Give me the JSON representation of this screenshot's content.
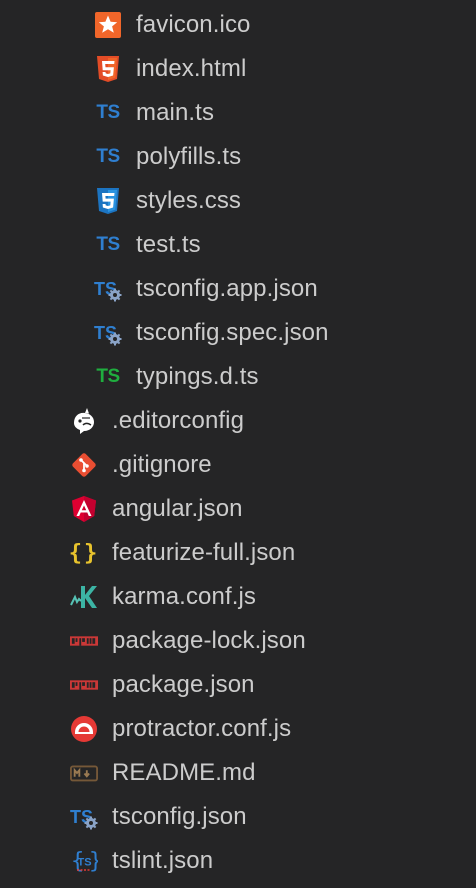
{
  "colors": {
    "background": "#252526",
    "text": "#cccccc",
    "ts_blue": "#2f7fd0",
    "ts_green": "#1fae3f",
    "html_orange": "#e34c26",
    "css_blue": "#1c74c1",
    "favicon_orange": "#f1662a",
    "angular_red": "#dd0031",
    "git_red": "#e94e32",
    "json_yellow": "#e8c32d",
    "karma_teal": "#56c3b5",
    "npm_red": "#cb3837",
    "protractor_red": "#e53935",
    "markdown_brown": "#755838"
  },
  "files": [
    {
      "label": "favicon.ico",
      "icon": "favicon-star-icon",
      "depth": 2
    },
    {
      "label": "index.html",
      "icon": "html5-icon",
      "depth": 2
    },
    {
      "label": "main.ts",
      "icon": "typescript-icon",
      "depth": 2
    },
    {
      "label": "polyfills.ts",
      "icon": "typescript-icon",
      "depth": 2
    },
    {
      "label": "styles.css",
      "icon": "css3-icon",
      "depth": 2
    },
    {
      "label": "test.ts",
      "icon": "typescript-icon",
      "depth": 2
    },
    {
      "label": "tsconfig.app.json",
      "icon": "tsconfig-icon",
      "depth": 2
    },
    {
      "label": "tsconfig.spec.json",
      "icon": "tsconfig-icon",
      "depth": 2
    },
    {
      "label": "typings.d.ts",
      "icon": "typescript-definition-icon",
      "depth": 2
    },
    {
      "label": ".editorconfig",
      "icon": "editorconfig-icon",
      "depth": 1
    },
    {
      "label": ".gitignore",
      "icon": "git-icon",
      "depth": 1
    },
    {
      "label": "angular.json",
      "icon": "angular-icon",
      "depth": 1
    },
    {
      "label": "featurize-full.json",
      "icon": "json-braces-icon",
      "depth": 1
    },
    {
      "label": "karma.conf.js",
      "icon": "karma-icon",
      "depth": 1
    },
    {
      "label": "package-lock.json",
      "icon": "npm-icon",
      "depth": 1
    },
    {
      "label": "package.json",
      "icon": "npm-icon",
      "depth": 1
    },
    {
      "label": "protractor.conf.js",
      "icon": "protractor-icon",
      "depth": 1
    },
    {
      "label": "README.md",
      "icon": "markdown-icon",
      "depth": 1
    },
    {
      "label": "tsconfig.json",
      "icon": "tsconfig-icon",
      "depth": 1
    },
    {
      "label": "tslint.json",
      "icon": "tslint-icon",
      "depth": 1
    }
  ]
}
